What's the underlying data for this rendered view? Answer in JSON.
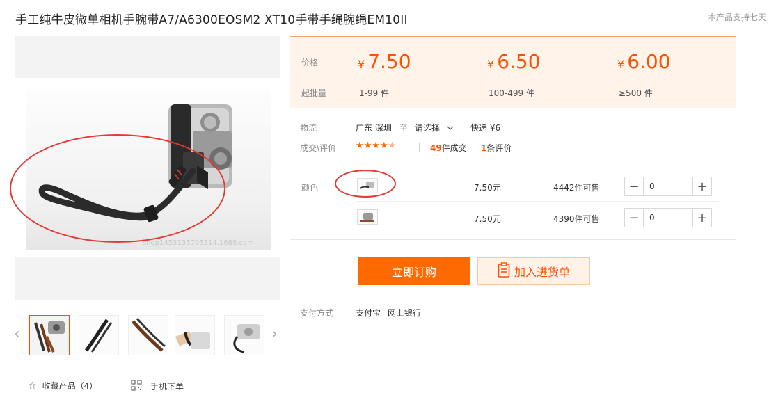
{
  "product": {
    "title": "手工纯牛皮微单相机手腕带A7/A6300EOSM2 XT10手带手绳腕绳EM10II",
    "support_text": "本产品支持七天"
  },
  "main_image": {
    "watermark": "shop1453135795314.1688.com"
  },
  "thumbnails": {
    "prev_icon": "‹",
    "next_icon": "›",
    "items": [
      {
        "name": "camera-with-straps"
      },
      {
        "name": "black-strap"
      },
      {
        "name": "brown-strap"
      },
      {
        "name": "strap-on-wrist"
      },
      {
        "name": "silver-camera-strap"
      }
    ]
  },
  "bottom_actions": {
    "favorite_label": "收藏产品（4）",
    "mobile_label": "手机下单"
  },
  "price_box": {
    "price_label": "价格",
    "moq_label": "起批量",
    "currency": "¥",
    "tiers": [
      {
        "price": "7.50",
        "range": "1-99 件"
      },
      {
        "price": "6.50",
        "range": "100-499 件"
      },
      {
        "price": "6.00",
        "range": "≥500 件"
      }
    ]
  },
  "logistics": {
    "label": "物流",
    "origin": "广东 深圳",
    "to": "至",
    "destination_placeholder": "请选择",
    "shipping": "快递 ¥6"
  },
  "deals": {
    "label": "成交\\评价",
    "rating": 4.5,
    "stars": "★★★★",
    "half_star": "★",
    "divider": "|",
    "sold_count": "49",
    "sold_suffix": "件成交",
    "review_count": "1",
    "review_suffix": "条评价"
  },
  "variants": {
    "label": "颜色",
    "rows": [
      {
        "price": "7.50元",
        "stock": "4442件可售",
        "qty": "0"
      },
      {
        "price": "7.50元",
        "stock": "4390件可售",
        "qty": "0"
      }
    ],
    "minus": "−",
    "plus": "+"
  },
  "buttons": {
    "buy_now": "立即订购",
    "add_to_cart": "加入进货单"
  },
  "payment": {
    "label": "支付方式",
    "methods": [
      "支付宝",
      "网上银行"
    ]
  },
  "colors": {
    "accent": "#ff5000",
    "buy_button": "#ff6a00",
    "price_bg": "#fff3ea",
    "annotation": "#e53935"
  }
}
